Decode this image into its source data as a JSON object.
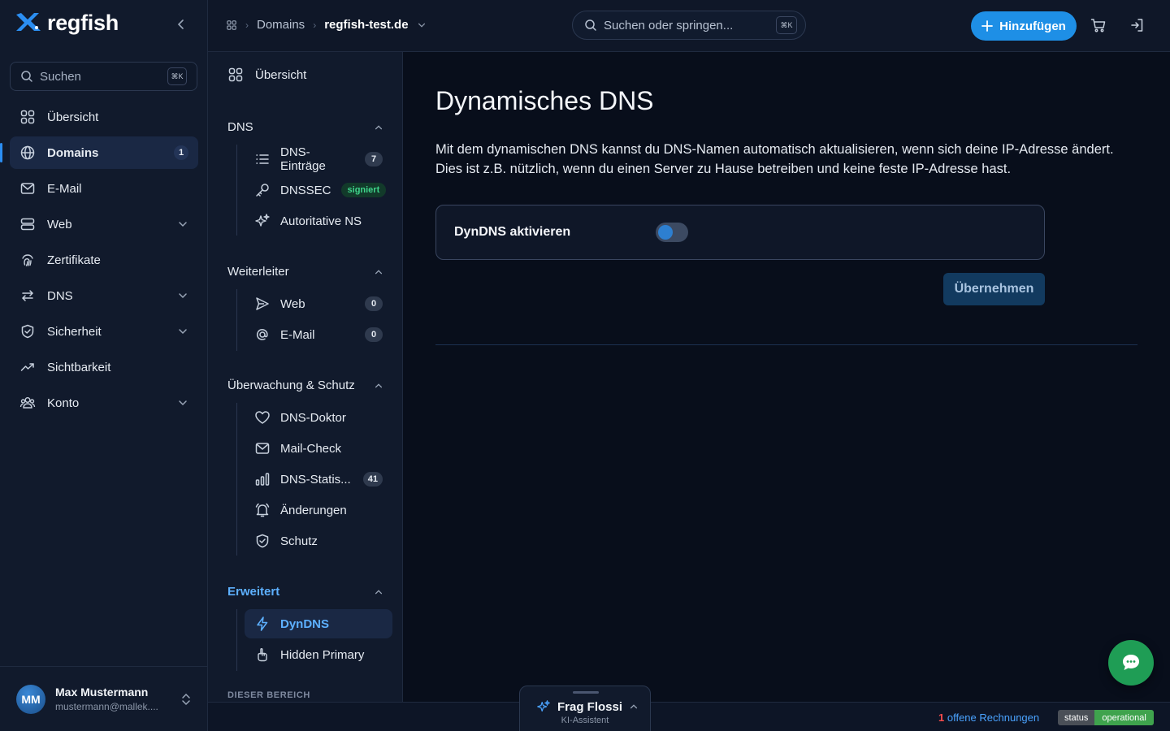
{
  "brand": {
    "name": "regfish"
  },
  "sidebar": {
    "search_placeholder": "Suchen",
    "search_shortcut": "⌘K",
    "items": [
      {
        "label": "Übersicht",
        "icon": "grid-icon"
      },
      {
        "label": "Domains",
        "icon": "globe-icon",
        "badge": "1",
        "active": true
      },
      {
        "label": "E-Mail",
        "icon": "mail-icon"
      },
      {
        "label": "Web",
        "icon": "server-icon",
        "expandable": true
      },
      {
        "label": "Zertifikate",
        "icon": "fingerprint-icon"
      },
      {
        "label": "DNS",
        "icon": "arrows-icon",
        "expandable": true
      },
      {
        "label": "Sicherheit",
        "icon": "shield-icon",
        "expandable": true
      },
      {
        "label": "Sichtbarkeit",
        "icon": "trend-icon"
      },
      {
        "label": "Konto",
        "icon": "users-icon",
        "expandable": true
      }
    ],
    "user": {
      "initials": "MM",
      "name": "Max Mustermann",
      "email": "mustermann@mallek...."
    }
  },
  "topbar": {
    "breadcrumb_root": "Domains",
    "breadcrumb_current": "regfish-test.de",
    "search_placeholder": "Suchen oder springen...",
    "search_shortcut": "⌘K",
    "add_label": "Hinzufügen"
  },
  "subnav": {
    "overview": "Übersicht",
    "sections": {
      "dns": {
        "title": "DNS",
        "items": [
          {
            "label": "DNS-Einträge",
            "count": "7"
          },
          {
            "label": "DNSSEC",
            "tag": "signiert"
          },
          {
            "label": "Autoritative NS"
          }
        ]
      },
      "forward": {
        "title": "Weiterleiter",
        "items": [
          {
            "label": "Web",
            "count": "0"
          },
          {
            "label": "E-Mail",
            "count": "0"
          }
        ]
      },
      "monitor": {
        "title": "Überwachung & Schutz",
        "items": [
          {
            "label": "DNS-Doktor"
          },
          {
            "label": "Mail-Check"
          },
          {
            "label": "DNS-Statis...",
            "count": "41"
          },
          {
            "label": "Änderungen"
          },
          {
            "label": "Schutz"
          }
        ]
      },
      "advanced": {
        "title": "Erweitert",
        "items": [
          {
            "label": "DynDNS",
            "active": true
          },
          {
            "label": "Hidden Primary"
          }
        ]
      }
    },
    "area_label": "DIESER BEREICH"
  },
  "main": {
    "title": "Dynamisches DNS",
    "description_1": "Mit dem dynamischen DNS kannst du DNS-Namen automatisch aktualisieren, wenn sich deine IP-Adresse ändert.",
    "description_2": "Dies ist z.B. nützlich, wenn du einen Server zu Hause betreiben und keine feste IP-Adresse hast.",
    "toggle_label": "DynDNS aktivieren",
    "toggle_on": false,
    "apply_label": "Übernehmen"
  },
  "assistant": {
    "title": "Frag Flossi",
    "subtitle": "KI-Assistent"
  },
  "footer": {
    "invoice_count": "1",
    "invoice_text": "offene Rechnungen",
    "status_key": "status",
    "status_value": "operational"
  },
  "colors": {
    "accent": "#1e8fe6",
    "background": "#0b1220",
    "success": "#1f9d55"
  }
}
